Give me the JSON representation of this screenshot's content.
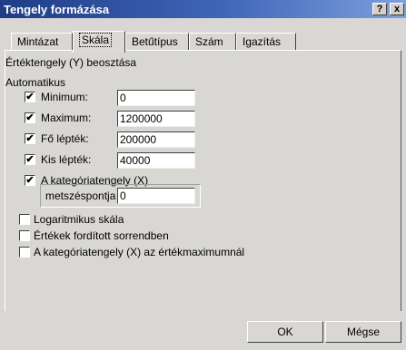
{
  "window": {
    "title": "Tengely formázása",
    "help": "?",
    "close": "x"
  },
  "tabs": [
    "Mintázat",
    "Skála",
    "Betűtípus",
    "Szám",
    "Igazítás"
  ],
  "scale": {
    "heading": "Értéktengely (Y) beosztása",
    "auto_label": "Automatikus",
    "rows": [
      {
        "label": "Minimum:",
        "checked": true,
        "value": "0"
      },
      {
        "label": "Maximum:",
        "checked": true,
        "value": "1200000"
      },
      {
        "label": "Fő lépték:",
        "checked": true,
        "value": "200000"
      },
      {
        "label": "Kis lépték:",
        "checked": true,
        "value": "40000"
      }
    ],
    "crosses_label": "A kategóriatengely (X)",
    "crosses_sub": "metszéspontja",
    "crosses_value": "0",
    "crosses_checked": true,
    "options": [
      {
        "label": "Logaritmikus skála",
        "checked": false
      },
      {
        "label": "Értékek fordított sorrendben",
        "checked": false
      },
      {
        "label": "A kategóriatengely (X) az értékmaximumnál",
        "checked": false
      }
    ]
  },
  "buttons": {
    "ok": "OK",
    "cancel": "Mégse"
  }
}
